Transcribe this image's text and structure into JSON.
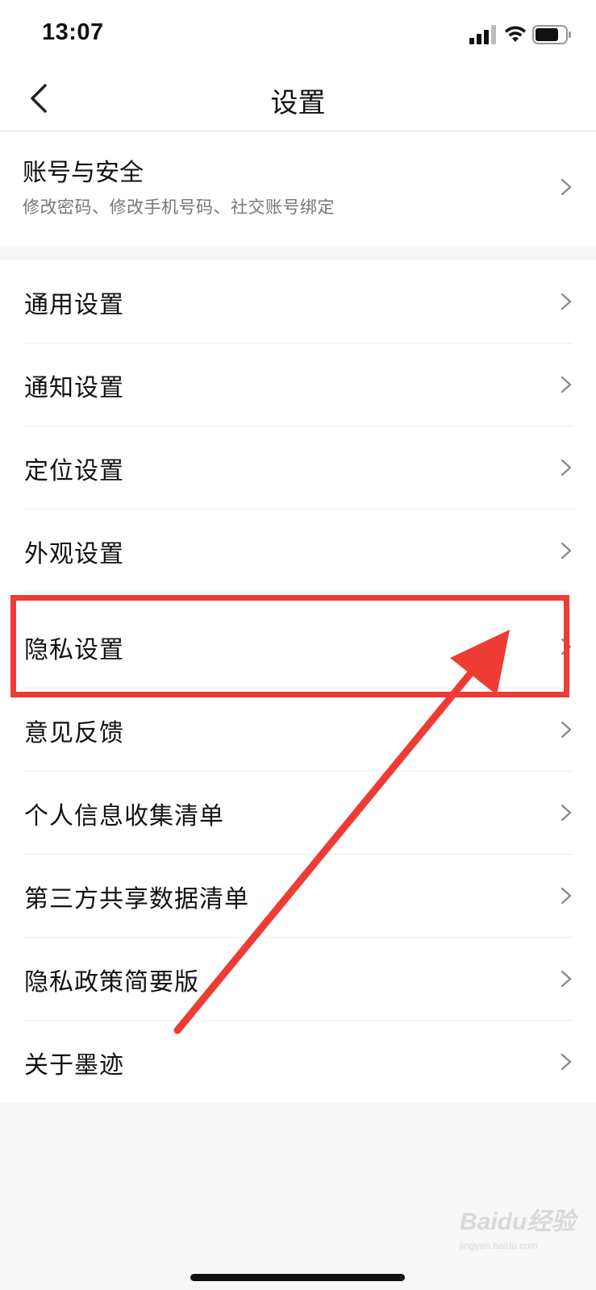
{
  "status_bar": {
    "time": "13:07",
    "icons": [
      "signal-icon",
      "wifi-icon",
      "battery-icon"
    ]
  },
  "nav": {
    "title": "设置",
    "back_icon": "chevron-left-icon"
  },
  "account": {
    "title": "账号与安全",
    "subtitle": "修改密码、修改手机号码、社交账号绑定"
  },
  "settings_list": {
    "items": [
      {
        "label": "通用设置"
      },
      {
        "label": "通知设置"
      },
      {
        "label": "定位设置"
      },
      {
        "label": "外观设置"
      },
      {
        "label": "隐私设置"
      },
      {
        "label": "意见反馈"
      },
      {
        "label": "个人信息收集清单"
      },
      {
        "label": "第三方共享数据清单"
      },
      {
        "label": "隐私政策简要版"
      },
      {
        "label": "关于墨迹"
      }
    ]
  },
  "annotation": {
    "highlight_color": "#ee3b34",
    "highlighted_item": "隐私设置"
  },
  "watermark": {
    "brand": "Baidu经验",
    "url": "jingyan.baidu.com"
  }
}
